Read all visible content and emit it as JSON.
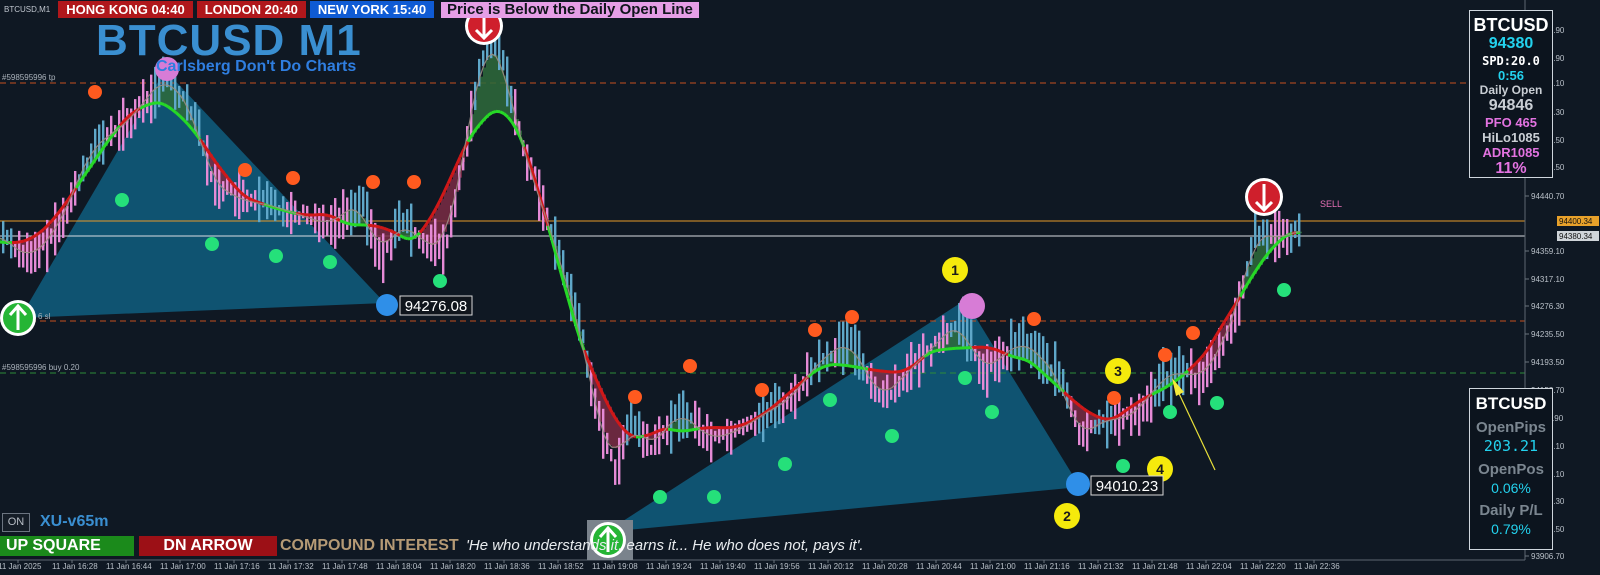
{
  "window": {
    "symbol_small": "BTCUSD,M1"
  },
  "sessions": [
    {
      "label": "HONG KONG 04:40"
    },
    {
      "label": "LONDON  20:40"
    },
    {
      "label": "NEW YORK 15:40"
    }
  ],
  "alert_text": "Price is Below the Daily Open Line",
  "title": "BTCUSD M1",
  "subtitle": "Carlsberg Don't Do Charts",
  "panel_top": {
    "symbol": "BTCUSD",
    "price": "94380",
    "spread": "SPD:20.0",
    "timer": "0:56",
    "daily_open_label": "Daily Open",
    "daily_open": "94846",
    "pfo": "PFO 465",
    "hilo": "HiLo1085",
    "adr": "ADR1085",
    "pct": "11%"
  },
  "panel_bottom": {
    "symbol": "BTCUSD",
    "open_pips_label": "OpenPips",
    "open_pips": "203.21",
    "open_pos_label": "OpenPos",
    "open_pos": "0.06%",
    "daily_pl_label": "Daily P/L",
    "daily_pl": "0.79%"
  },
  "bottom_bar": {
    "on_label": "ON",
    "version": "XU-v65m",
    "up_square": "UP SQUARE",
    "dn_arrow": "DN ARROW",
    "compound": "COMPOUND INTEREST",
    "quote": "'He who understands it, earns it... He who does not, pays it'."
  },
  "chart_labels": {
    "tp_line": "#598595996 tp",
    "sl_line": "6 sl",
    "buy_line": "#598595996 buy 0.20",
    "sell_text": "SELL",
    "price_box_1": "94276.08",
    "price_box_2": "94010.23",
    "marker_1": "1",
    "marker_2": "2",
    "marker_3": "3",
    "marker_4": "4",
    "orange_line_price": "94400.34",
    "white_line_price": "94380.34"
  },
  "y_axis": [
    "94687.90",
    "94645.90",
    "94605.10",
    "94564.30",
    "94523.50",
    "94481.50",
    "94440.70",
    "94359.10",
    "94317.10",
    "94276.30",
    "94235.50",
    "94193.50",
    "94152.70",
    "94111.90",
    "94071.10",
    "94029.10",
    "93988.30",
    "93947.50",
    "93906.70"
  ],
  "x_axis": [
    "11 Jan 2025",
    "11 Jan 16:28",
    "11 Jan 16:44",
    "11 Jan 17:00",
    "11 Jan 17:16",
    "11 Jan 17:32",
    "11 Jan 17:48",
    "11 Jan 18:04",
    "11 Jan 18:20",
    "11 Jan 18:36",
    "11 Jan 18:52",
    "11 Jan 19:08",
    "11 Jan 19:24",
    "11 Jan 19:40",
    "11 Jan 19:56",
    "11 Jan 20:12",
    "11 Jan 20:28",
    "11 Jan 20:44",
    "11 Jan 21:00",
    "11 Jan 21:16",
    "11 Jan 21:32",
    "11 Jan 21:48",
    "11 Jan 22:04",
    "11 Jan 22:20",
    "11 Jan 22:36"
  ],
  "colors": {
    "bg": "#0f1823",
    "bull_band": "#2e6b3b",
    "bear_band": "#7a2b44",
    "ma_green": "#26d926",
    "ma_red": "#d01818",
    "triangle": "#0f5a7a"
  },
  "chart_data": {
    "type": "candlestick",
    "series": [
      {
        "name": "BTCUSD M1"
      }
    ],
    "levels": {
      "tp": 94605,
      "sl": 94255,
      "buy": 94183,
      "orange": 94400.34,
      "white": 94380.34
    }
  }
}
